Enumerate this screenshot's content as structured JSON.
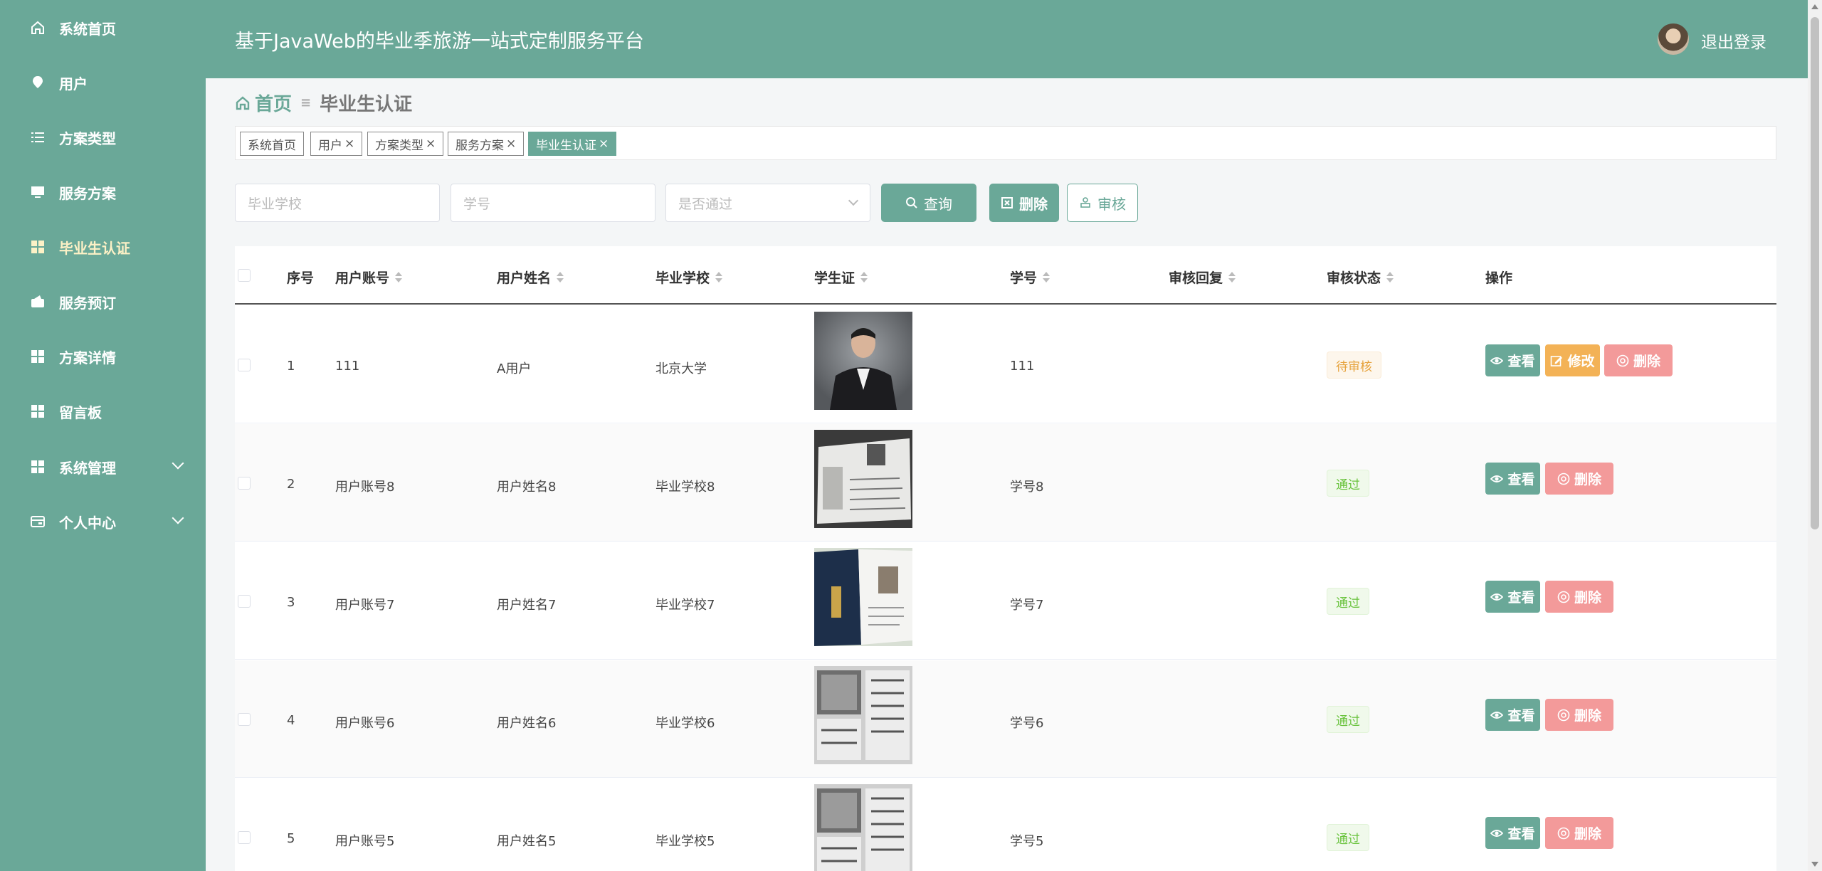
{
  "app": {
    "title": "基于JavaWeb的毕业季旅游一站式定制服务平台",
    "logout_label": "退出登录"
  },
  "colors": {
    "primary": "#6aa898",
    "active_menu": "#fdf1c6",
    "edit": "#f3b256",
    "delete": "#f39a9a",
    "pending": "#e6a23c",
    "pass": "#67c23a"
  },
  "sidebar": {
    "items": [
      {
        "label": "系统首页",
        "icon": "home-icon"
      },
      {
        "label": "用户",
        "icon": "location-pin-icon"
      },
      {
        "label": "方案类型",
        "icon": "list-icon"
      },
      {
        "label": "服务方案",
        "icon": "monitor-icon"
      },
      {
        "label": "毕业生认证",
        "icon": "grid-icon",
        "active": true
      },
      {
        "label": "服务预订",
        "icon": "wallet-icon"
      },
      {
        "label": "方案详情",
        "icon": "grid-icon"
      },
      {
        "label": "留言板",
        "icon": "grid-icon"
      },
      {
        "label": "系统管理",
        "icon": "grid-icon",
        "expandable": true
      },
      {
        "label": "个人中心",
        "icon": "card-icon",
        "expandable": true
      }
    ]
  },
  "breadcrumb": {
    "home": "首页",
    "current": "毕业生认证"
  },
  "tags": [
    {
      "label": "系统首页",
      "closable": false
    },
    {
      "label": "用户",
      "closable": true
    },
    {
      "label": "方案类型",
      "closable": true
    },
    {
      "label": "服务方案",
      "closable": true
    },
    {
      "label": "毕业生认证",
      "closable": true,
      "active": true
    }
  ],
  "search": {
    "school_placeholder": "毕业学校",
    "student_no_placeholder": "学号",
    "passed_placeholder": "是否通过",
    "query_label": "查询",
    "delete_label": "删除",
    "review_label": "审核"
  },
  "table": {
    "headers": {
      "index": "序号",
      "account": "用户账号",
      "name": "用户姓名",
      "school": "毕业学校",
      "card": "学生证",
      "student_no": "学号",
      "reply": "审核回复",
      "status": "审核状态",
      "ops": "操作"
    },
    "actions": {
      "view": "查看",
      "edit": "修改",
      "delete": "删除"
    },
    "rows": [
      {
        "index": "1",
        "account": "111",
        "name": "A用户",
        "school": "北京大学",
        "student_no": "111",
        "reply": "",
        "status": "待审核",
        "editable": true
      },
      {
        "index": "2",
        "account": "用户账号8",
        "name": "用户姓名8",
        "school": "毕业学校8",
        "student_no": "学号8",
        "reply": "",
        "status": "通过",
        "editable": false
      },
      {
        "index": "3",
        "account": "用户账号7",
        "name": "用户姓名7",
        "school": "毕业学校7",
        "student_no": "学号7",
        "reply": "",
        "status": "通过",
        "editable": false
      },
      {
        "index": "4",
        "account": "用户账号6",
        "name": "用户姓名6",
        "school": "毕业学校6",
        "student_no": "学号6",
        "reply": "",
        "status": "通过",
        "editable": false
      },
      {
        "index": "5",
        "account": "用户账号5",
        "name": "用户姓名5",
        "school": "毕业学校5",
        "student_no": "学号5",
        "reply": "",
        "status": "通过",
        "editable": false
      }
    ]
  }
}
